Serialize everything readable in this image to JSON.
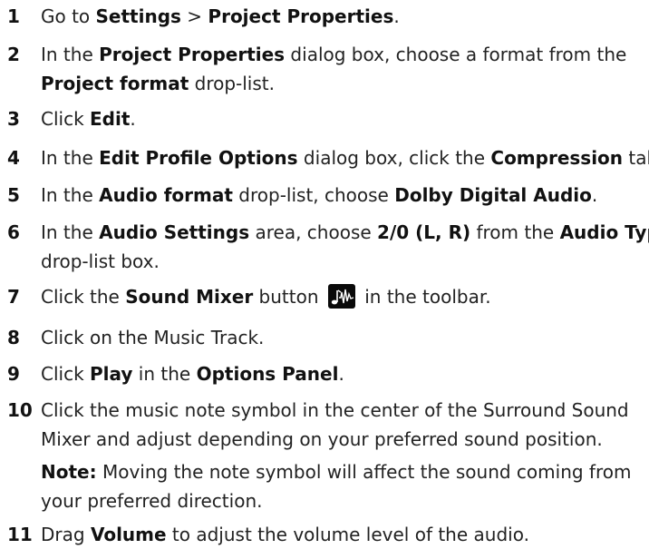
{
  "steps": [
    {
      "num": "1",
      "parts": [
        {
          "t": "Go to "
        },
        {
          "t": "Settings",
          "b": true
        },
        {
          "t": " > "
        },
        {
          "t": "Project Properties",
          "b": true
        },
        {
          "t": "."
        }
      ]
    },
    {
      "num": "2",
      "parts": [
        {
          "t": "In the "
        },
        {
          "t": "Project Properties",
          "b": true
        },
        {
          "t": " dialog box, choose a format from the"
        },
        {
          "br": true
        },
        {
          "t": "Project format",
          "b": true
        },
        {
          "t": " drop-list."
        }
      ]
    },
    {
      "num": "3",
      "parts": [
        {
          "t": "Click "
        },
        {
          "t": "Edit",
          "b": true
        },
        {
          "t": "."
        }
      ]
    },
    {
      "num": "4",
      "parts": [
        {
          "t": "In the "
        },
        {
          "t": "Edit Profile Options",
          "b": true
        },
        {
          "t": " dialog box, click the "
        },
        {
          "t": "Compression",
          "b": true
        },
        {
          "t": " tab."
        }
      ]
    },
    {
      "num": "5",
      "parts": [
        {
          "t": "In the "
        },
        {
          "t": "Audio format",
          "b": true
        },
        {
          "t": " drop-list, choose "
        },
        {
          "t": "Dolby Digital Audio",
          "b": true
        },
        {
          "t": "."
        }
      ]
    },
    {
      "num": "6",
      "parts": [
        {
          "t": "In the "
        },
        {
          "t": "Audio Settings",
          "b": true
        },
        {
          "t": " area, choose "
        },
        {
          "t": "2/0 (L, R)",
          "b": true
        },
        {
          "t": " from the "
        },
        {
          "t": "Audio Type",
          "b": true
        },
        {
          "br": true
        },
        {
          "t": "drop-list box."
        }
      ]
    },
    {
      "num": "7",
      "parts": [
        {
          "t": "Click the "
        },
        {
          "t": "Sound Mixer",
          "b": true
        },
        {
          "t": " button "
        },
        {
          "icon": "sound-mixer-icon"
        },
        {
          "t": " in the toolbar."
        }
      ]
    },
    {
      "num": "8",
      "parts": [
        {
          "t": "Click on the Music Track."
        }
      ]
    },
    {
      "num": "9",
      "parts": [
        {
          "t": "Click "
        },
        {
          "t": "Play",
          "b": true
        },
        {
          "t": " in the "
        },
        {
          "t": "Options Panel",
          "b": true
        },
        {
          "t": "."
        }
      ]
    },
    {
      "num": "10",
      "parts": [
        {
          "t": "Click the music note symbol in the center of the Surround Sound"
        },
        {
          "br": true
        },
        {
          "t": "Mixer and adjust depending on your preferred sound position."
        },
        {
          "note": true
        },
        {
          "t": "Note:",
          "b": true
        },
        {
          "t": "  Moving the note symbol will affect the sound coming from"
        },
        {
          "br": true
        },
        {
          "t": "your preferred direction."
        }
      ]
    },
    {
      "num": "11",
      "parts": [
        {
          "t": "Drag "
        },
        {
          "t": "Volume",
          "b": true
        },
        {
          "t": " to adjust the volume level of the audio."
        }
      ]
    }
  ]
}
